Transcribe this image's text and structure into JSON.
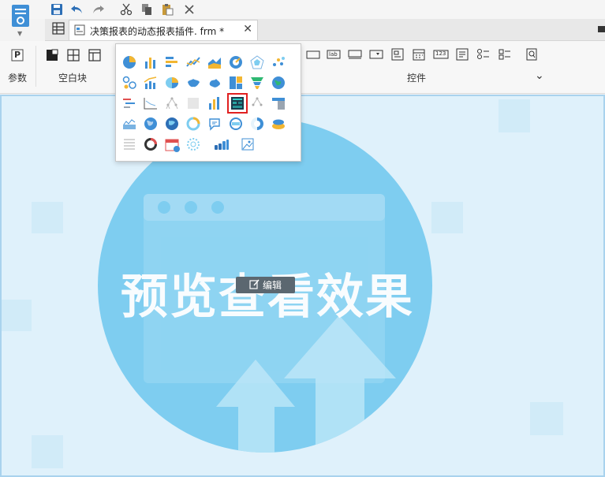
{
  "tab": {
    "file_label": "决策报表的动态报表插件. frm *",
    "close_glyph": "✕"
  },
  "ribbon": {
    "param_label": "参数",
    "param_icon_letter": "P",
    "blank_block_label": "空白块",
    "controls_label": "控件",
    "collapse_glyph": "⌄",
    "lab_text": "lab",
    "num_text": "123"
  },
  "canvas": {
    "preview_text": "预览查看效果",
    "edit_label": "编辑"
  },
  "colors": {
    "accent": "#3f8fd6",
    "canvas_bg": "#dff1fb",
    "circle": "#7ecdf0",
    "selection": "#e02020"
  }
}
